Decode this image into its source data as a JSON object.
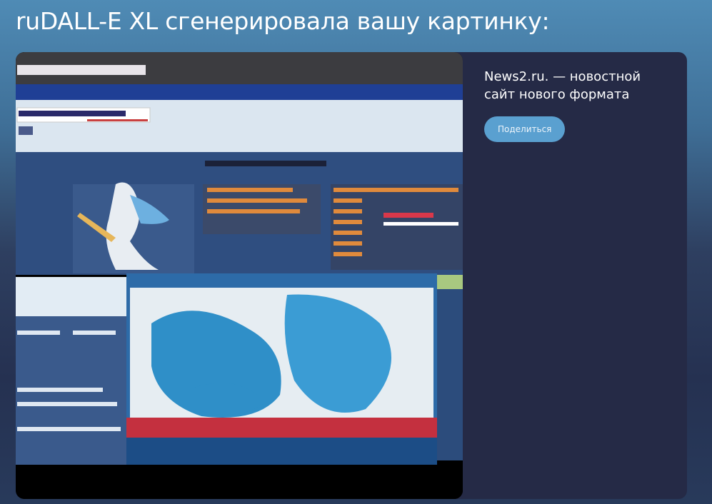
{
  "header": {
    "title": "ruDALL-E XL сгенерировала вашу картинку:"
  },
  "card": {
    "image_alt": "сгенерированная картинка",
    "source_text": "News2.ru. — новостной сайт нового формата",
    "share_label": "Поделиться"
  },
  "colors": {
    "button": "#5aa0d0",
    "card_bg": "#252a46",
    "map_water": "#2f8fc8"
  },
  "icons": {
    "image": "generated-picture"
  }
}
